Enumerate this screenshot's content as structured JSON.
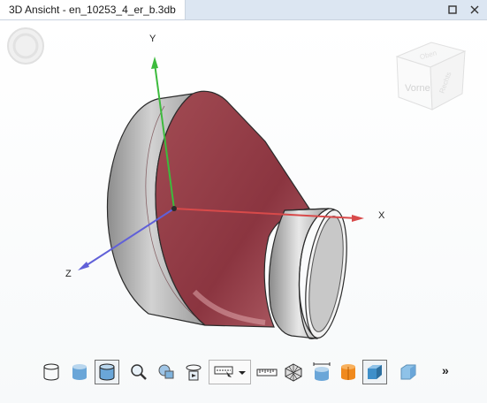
{
  "window": {
    "title": "3D Ansicht - en_10253_4_er_b.3db"
  },
  "scene": {
    "axes": {
      "x": "X",
      "y": "Y",
      "z": "Z"
    },
    "view_cube_label": "Vorne",
    "view_cube_side_label": "Rechts",
    "view_cube_top_label": "Oben"
  },
  "toolbar": {
    "more_label": "»",
    "tools": [
      "cylinder-wireframe-icon",
      "cylinder-shaded-icon",
      "cylinder-shaded-edges-icon",
      "zoom-icon",
      "zoom-fit-icon",
      "rotate-icon",
      "view-select-icon",
      "measure-ruler-icon",
      "mesh-icon",
      "dimension-icon",
      "section-icon",
      "shaded-box-icon",
      "transparent-box-icon"
    ]
  }
}
